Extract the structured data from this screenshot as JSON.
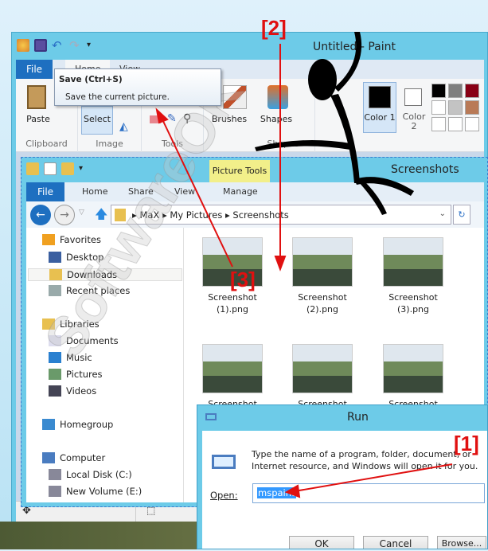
{
  "paint": {
    "title": "Untitled - Paint",
    "tabs": [
      "File",
      "Home",
      "View"
    ],
    "groups": {
      "clipboard": "Clipboard",
      "image": "Image",
      "tools": "Tools",
      "shapes": "Shapes"
    },
    "buttons": {
      "paste": "Paste",
      "select": "Select",
      "brushes": "Brushes",
      "shapes": "Shapes",
      "color1": "Color 1",
      "color2": "Color 2"
    },
    "palette": [
      "#000000",
      "#7f7f7f",
      "#880015",
      "#ffffff",
      "#c3c3c3",
      "#b97a57",
      "#ffffff",
      "#ffffff",
      "#ffffff"
    ],
    "tooltip": {
      "title": "Save (Ctrl+S)",
      "body": "Save the current picture."
    }
  },
  "explorer": {
    "title": "Screenshots",
    "context_tab": "Picture Tools",
    "tabs": [
      "File",
      "Home",
      "Share",
      "View",
      "Manage"
    ],
    "breadcrumb": [
      "MaX",
      "My Pictures",
      "Screenshots"
    ],
    "nav": [
      {
        "label": "Favorites",
        "top": true,
        "icon": "star-icon"
      },
      {
        "label": "Desktop",
        "icon": "desktop-icon"
      },
      {
        "label": "Downloads",
        "icon": "downloads-icon",
        "selected": true
      },
      {
        "label": "Recent places",
        "icon": "recent-places-icon"
      },
      {
        "label": "Libraries",
        "top": true,
        "icon": "libraries-icon"
      },
      {
        "label": "Documents",
        "icon": "documents-icon"
      },
      {
        "label": "Music",
        "icon": "music-icon"
      },
      {
        "label": "Pictures",
        "icon": "pictures-icon"
      },
      {
        "label": "Videos",
        "icon": "videos-icon"
      },
      {
        "label": "Homegroup",
        "top": true,
        "icon": "homegroup-icon"
      },
      {
        "label": "Computer",
        "top": true,
        "icon": "computer-icon"
      },
      {
        "label": "Local Disk (C:)",
        "icon": "drive-icon"
      },
      {
        "label": "New Volume (E:)",
        "icon": "drive-icon"
      }
    ],
    "files": [
      "Screenshot (1).png",
      "Screenshot (2).png",
      "Screenshot (3).png",
      "Screenshot",
      "Screenshot",
      "Screenshot"
    ]
  },
  "run": {
    "title": "Run",
    "description": "Type the name of a program, folder, document, or Internet resource, and Windows will open it for you.",
    "open_label": "Open:",
    "open_value": "mspaint",
    "ok": "OK",
    "cancel": "Cancel",
    "browse": "Browse..."
  },
  "annotations": [
    "[1]",
    "[2]",
    "[3]"
  ],
  "watermark": "SoftwareOK.com",
  "colors": {
    "titlebar": "#6dcbe8",
    "file_tab": "#1e6fc0",
    "annotation": "#e01010",
    "context_tab": "#f2ef8a"
  }
}
